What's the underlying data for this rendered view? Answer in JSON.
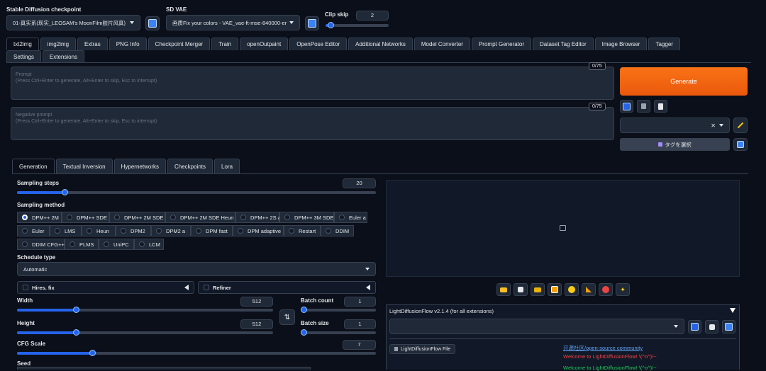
{
  "top": {
    "checkpoint_label": "Stable Diffusion checkpoint",
    "checkpoint_value": "01-真实系(现实_LEOSAM's MoonFilm胶片风真)",
    "vae_label": "SD VAE",
    "vae_value": "画质Fix your colors - VAE_vae-ft-mse-840000-er",
    "clip_skip_label": "Clip skip",
    "clip_skip_value": "2"
  },
  "main_tabs": [
    "txt2img",
    "img2img",
    "Extras",
    "PNG Info",
    "Checkpoint Merger",
    "Train",
    "openOutpaint",
    "OpenPose Editor",
    "Additional Networks",
    "Model Converter",
    "Prompt Generator",
    "Dataset Tag Editor",
    "Image Browser",
    "Tagger",
    "Settings",
    "Extensions"
  ],
  "prompt": {
    "label": "Prompt",
    "hint": "(Press Ctrl+Enter to generate, Alt+Enter to skip, Esc to interrupt)",
    "counter": "0/75"
  },
  "negative_prompt": {
    "label": "Negative prompt",
    "hint": "(Press Ctrl+Enter to generate, Alt+Enter to skip, Esc to interrupt)",
    "counter": "0/75"
  },
  "generate_label": "Generate",
  "tag_select_label": "タグを選択",
  "sub_tabs": [
    "Generation",
    "Textual Inversion",
    "Hypernetworks",
    "Checkpoints",
    "Lora"
  ],
  "sampling_steps": {
    "label": "Sampling steps",
    "value": "20",
    "fraction": 0.13
  },
  "sampling_method": {
    "label": "Sampling method",
    "rows": [
      [
        "DPM++ 2M",
        "DPM++ SDE",
        "DPM++ 2M SDE",
        "DPM++ 2M SDE Heun",
        "DPM++ 2S a",
        "DPM++ 3M SDE",
        "Euler a"
      ],
      [
        "Euler",
        "LMS",
        "Heun",
        "DPM2",
        "DPM2 a",
        "DPM fast",
        "DPM adaptive",
        "Restart",
        "DDIM"
      ],
      [
        "DDIM CFG++",
        "PLMS",
        "UniPC",
        "LCM"
      ]
    ],
    "selected": "DPM++ 2M"
  },
  "schedule": {
    "label": "Schedule type",
    "value": "Automatic"
  },
  "hires_fix_label": "Hires. fix",
  "refiner_label": "Refiner",
  "width": {
    "label": "Width",
    "value": "512",
    "fraction": 0.23
  },
  "height": {
    "label": "Height",
    "value": "512",
    "fraction": 0.23
  },
  "batch_count": {
    "label": "Batch count",
    "value": "1",
    "fraction": 0.0
  },
  "batch_size": {
    "label": "Batch size",
    "value": "1",
    "fraction": 0.0
  },
  "cfg": {
    "label": "CFG Scale",
    "value": "7",
    "fraction": 0.21
  },
  "seed_label": "Seed",
  "ldf": {
    "title": "LightDiffusionFlow v2.1.4 (for all extensions)",
    "file_button": "LightDiffusionFlow File",
    "community_link": "开源社区/open-source community",
    "welcome_red": "Welcome to LightDiffusionFlow! \\(^o^)/~",
    "welcome_green": "Welcome to LightDiffusionFlow! \\(^o^)/~"
  },
  "colors": {
    "accent": "#f97316",
    "blue": "#2563eb",
    "bg": "#0b0f19",
    "panel": "#1f2937"
  },
  "icons": {
    "refresh": "refresh-icon",
    "check": "checkbox-icon",
    "trash": "trash-icon",
    "clipboard": "clipboard-icon",
    "pencil": "pencil-icon",
    "swap": "swap-icon",
    "image": "image-placeholder-icon",
    "toolbar": [
      "folder-icon",
      "save-icon",
      "zip-icon",
      "image-send-icon",
      "palette-icon",
      "triangle-ruler-icon",
      "extras-icon",
      "sparkle-icon"
    ]
  }
}
